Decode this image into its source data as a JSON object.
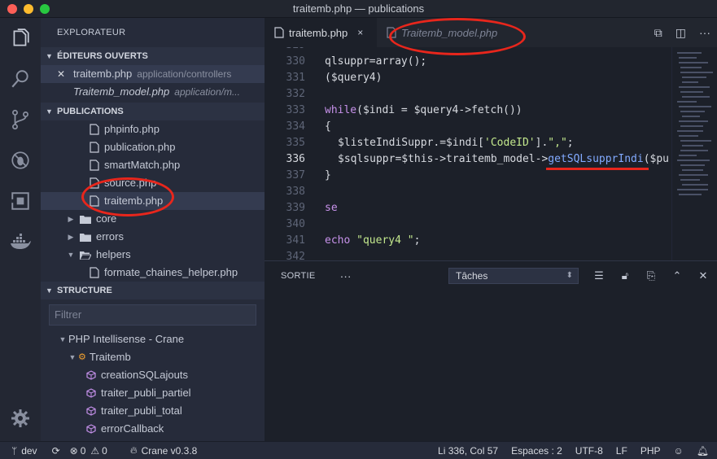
{
  "window": {
    "title": "traitemb.php — publications"
  },
  "sidebar": {
    "title": "EXPLORATEUR",
    "open_editors": {
      "header": "ÉDITEURS OUVERTS",
      "items": [
        {
          "name": "traitemb.php",
          "path": "application/controllers"
        },
        {
          "name": "Traitemb_model.php",
          "path": "application/m..."
        }
      ]
    },
    "publications": {
      "header": "PUBLICATIONS",
      "files": [
        "phpinfo.php",
        "publication.php",
        "smartMatch.php",
        "source.php",
        "traitemb.php"
      ],
      "folders": [
        "core",
        "errors",
        "helpers"
      ],
      "helper_files": [
        "formate_chaines_helper.php"
      ]
    },
    "structure": {
      "header": "STRUCTURE",
      "filter_placeholder": "Filtrer",
      "root": "PHP Intellisense - Crane",
      "class": "Traitemb",
      "methods": [
        "creationSQLajouts",
        "traiter_publi_partiel",
        "traiter_publi_total",
        "errorCallback"
      ]
    }
  },
  "editor": {
    "tabs": [
      {
        "label": "traitemb.php",
        "close": "×"
      },
      {
        "label": "Traitemb_model.php"
      }
    ],
    "line_numbers": [
      "330",
      "331",
      "332",
      "333",
      "334",
      "335",
      "336",
      "337",
      "338",
      "339",
      "340",
      "341",
      "342"
    ],
    "current_line": "336",
    "code": {
      "l330": "qlsuppr=array();",
      "l331": "($query4)",
      "l333_kw": "while",
      "l333_rest": "($indi = $query4->fetch())",
      "l334": "{",
      "l335_a": "$listeIndiSuppr.=$indi[",
      "l335_str": "'CodeID'",
      "l335_b": "].",
      "l335_str2": "\",\"",
      "l335_c": ";",
      "l336_a": "$sqlsuppr=$this->traitemb_model->",
      "l336_fn": "getSQLsupprIndi",
      "l336_b": "($pu",
      "l337": "}",
      "l339": "se",
      "l341_a": "echo ",
      "l341_str": "\"query4 \"",
      "l341_b": ";"
    }
  },
  "panel": {
    "tab": "SORTIE",
    "more": "···",
    "select_value": "Tâches"
  },
  "status": {
    "branch": "dev",
    "errors": "0",
    "warnings": "0",
    "crane": "Crane v0.3.8",
    "position": "Li 336, Col 57",
    "spaces": "Espaces : 2",
    "encoding": "UTF-8",
    "eol": "LF",
    "language": "PHP"
  },
  "colors": {
    "annotation_red": "#e8261c",
    "accent_blue": "#82aaff",
    "traffic_red": "#fc5f57",
    "traffic_yellow": "#fdbc2e",
    "traffic_green": "#28c840"
  }
}
